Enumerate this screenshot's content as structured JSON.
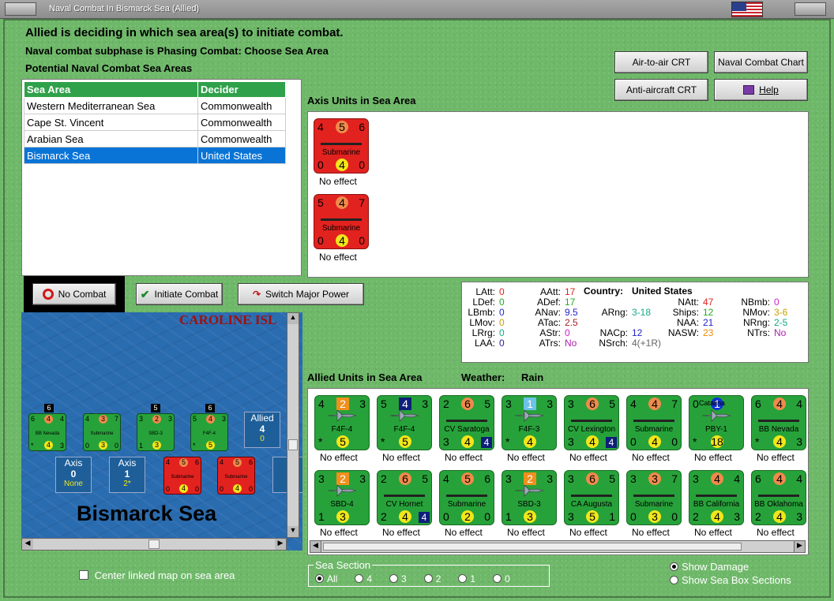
{
  "window": {
    "title": "Naval Combat In Bismarck Sea (Allied)"
  },
  "header": {
    "line1": "Allied is deciding in which sea area(s) to initiate combat.",
    "line2": "Naval combat subphase is Phasing Combat: Choose Sea Area",
    "line3": "Potential Naval Combat Sea Areas"
  },
  "sea_table": {
    "columns": [
      "Sea Area",
      "Decider"
    ],
    "rows": [
      [
        "Western Mediterranean Sea",
        "Commonwealth"
      ],
      [
        "Cape St. Vincent",
        "Commonwealth"
      ],
      [
        "Arabian Sea",
        "Commonwealth"
      ],
      [
        "Bismarck Sea",
        "United States"
      ]
    ],
    "selected_row": 3
  },
  "buttons": {
    "air_to_air": "Air-to-air CRT",
    "naval_chart": "Naval Combat Chart",
    "anti_aircraft": "Anti-aircraft CRT",
    "help": "Help",
    "no_combat": "No Combat",
    "initiate": "Initiate Combat",
    "switch_power": "Switch Major Power"
  },
  "axis_section": {
    "title": "Axis Units in Sea Area",
    "units": [
      {
        "tl": "4",
        "top": "5",
        "tr": "6",
        "name": "Submarine",
        "bl": "0",
        "bot": "4",
        "br": "0",
        "effect": "No effect"
      },
      {
        "tl": "5",
        "top": "4",
        "tr": "7",
        "name": "Submarine",
        "bl": "0",
        "bot": "4",
        "br": "0",
        "effect": "No effect"
      }
    ]
  },
  "stats": {
    "country_label": "Country:",
    "country": "United States",
    "items": [
      {
        "k": "LAtt:",
        "v": "0",
        "c": "#d22"
      },
      {
        "k": "LDef:",
        "v": "0",
        "c": "#2a2"
      },
      {
        "k": "LBmb:",
        "v": "0",
        "c": "#22c"
      },
      {
        "k": "LMov:",
        "v": "0",
        "c": "#c8a000"
      },
      {
        "k": "LRrg:",
        "v": "0",
        "c": "#1a8"
      },
      {
        "k": "LAA:",
        "v": "0",
        "c": "#229"
      },
      {
        "k": "AAtt:",
        "v": "17",
        "c": "#d22"
      },
      {
        "k": "ADef:",
        "v": "17",
        "c": "#2a2"
      },
      {
        "k": "ANav:",
        "v": "9.5",
        "c": "#22c"
      },
      {
        "k": "ATac:",
        "v": "2.5",
        "c": "#a22"
      },
      {
        "k": "AStr:",
        "v": "0",
        "c": "#c2c"
      },
      {
        "k": "ATrs:",
        "v": "No",
        "c": "#a2a"
      },
      {
        "k": "ARng:",
        "v": "3-18",
        "c": "#1a8"
      },
      {
        "k": "NACp:",
        "v": "12",
        "c": "#22c"
      },
      {
        "k": "NSrch:",
        "v": "4(+1R)",
        "c": "#666"
      },
      {
        "k": "NAtt:",
        "v": "47",
        "c": "#d22"
      },
      {
        "k": "Ships:",
        "v": "12",
        "c": "#2a2"
      },
      {
        "k": "NAA:",
        "v": "21",
        "c": "#22c"
      },
      {
        "k": "NASW:",
        "v": "23",
        "c": "#e80"
      },
      {
        "k": "NBmb:",
        "v": "0",
        "c": "#c2c"
      },
      {
        "k": "NMov:",
        "v": "3-6",
        "c": "#c8a000"
      },
      {
        "k": "NRng:",
        "v": "2-5",
        "c": "#1a8"
      },
      {
        "k": "NTrs:",
        "v": "No",
        "c": "#a2a"
      }
    ]
  },
  "allied_section": {
    "title": "Allied Units in Sea Area",
    "weather_label": "Weather:",
    "weather": "Rain",
    "units": [
      {
        "tl": "4",
        "top": "2",
        "tr": "3",
        "tstyle": "sq-orange",
        "name": "F4F-4",
        "kind": "plane",
        "bl": "*",
        "bot": "5",
        "br": "",
        "effect": "No effect"
      },
      {
        "tl": "5",
        "top": "4",
        "tr": "3",
        "tstyle": "sq-navy",
        "name": "F4F-4",
        "kind": "plane",
        "bl": "*",
        "bot": "5",
        "br": "",
        "effect": "No effect"
      },
      {
        "tl": "2",
        "top": "6",
        "tr": "5",
        "tstyle": "circle-orange",
        "name": "CV Saratoga",
        "kind": "ship",
        "bl": "3",
        "bot": "4",
        "br": "4",
        "effect": "No effect"
      },
      {
        "tl": "3",
        "top": "1",
        "tr": "3",
        "tstyle": "sq-lightblue",
        "name": "F4F-3",
        "kind": "plane",
        "bl": "*",
        "bot": "4",
        "br": "",
        "effect": "No effect"
      },
      {
        "tl": "3",
        "top": "6",
        "tr": "5",
        "tstyle": "circle-orange",
        "name": "CV Lexington",
        "kind": "ship",
        "bl": "3",
        "bot": "4",
        "br": "4",
        "effect": "No effect"
      },
      {
        "tl": "4",
        "top": "4",
        "tr": "7",
        "tstyle": "circle-orange",
        "name": "Submarine",
        "kind": "ship",
        "bl": "0",
        "bot": "4",
        "br": "0",
        "effect": "No effect"
      },
      {
        "tl": "0",
        "top": "1",
        "tr": "",
        "tstyle": "circle-blue",
        "name": "PBY-1",
        "kind": "plane",
        "label2": "Catalina",
        "bl": "*",
        "bot": "18",
        "br": "",
        "effect": "No effect"
      },
      {
        "tl": "6",
        "top": "4",
        "tr": "4",
        "tstyle": "circle-orange",
        "name": "BB Nevada",
        "kind": "ship",
        "bl": "*",
        "bot": "4",
        "br": "3",
        "effect": "No effect"
      },
      {
        "tl": "3",
        "top": "2",
        "tr": "3",
        "tstyle": "sq-orange",
        "name": "SBD-4",
        "kind": "plane",
        "bl": "1",
        "bot": "3",
        "br": "",
        "effect": "No effect"
      },
      {
        "tl": "2",
        "top": "6",
        "tr": "5",
        "tstyle": "circle-orange",
        "name": "CV Hornet",
        "kind": "ship",
        "bl": "2",
        "bot": "4",
        "br": "4",
        "effect": "No effect"
      },
      {
        "tl": "4",
        "top": "5",
        "tr": "6",
        "tstyle": "circle-orange",
        "name": "Submarine",
        "kind": "ship",
        "bl": "0",
        "bot": "2",
        "br": "0",
        "effect": "No effect"
      },
      {
        "tl": "3",
        "top": "2",
        "tr": "3",
        "tstyle": "sq-orange",
        "name": "SBD-3",
        "kind": "plane",
        "bl": "1",
        "bot": "3",
        "br": "",
        "effect": "No effect"
      },
      {
        "tl": "3",
        "top": "6",
        "tr": "5",
        "tstyle": "circle-orange",
        "name": "CA Augusta",
        "kind": "ship",
        "bl": "3",
        "bot": "5",
        "br": "1",
        "effect": "No effect"
      },
      {
        "tl": "3",
        "top": "3",
        "tr": "7",
        "tstyle": "circle-orange",
        "name": "Submarine",
        "kind": "ship",
        "bl": "0",
        "bot": "3",
        "br": "0",
        "effect": "No effect"
      },
      {
        "tl": "3",
        "top": "4",
        "tr": "4",
        "tstyle": "circle-orange",
        "name": "BB California",
        "kind": "ship",
        "bl": "2",
        "bot": "4",
        "br": "3",
        "effect": "No effect"
      },
      {
        "tl": "6",
        "top": "4",
        "tr": "4",
        "tstyle": "circle-orange",
        "name": "BB Oklahoma",
        "kind": "ship",
        "bl": "2",
        "bot": "4",
        "br": "3",
        "effect": "No effect"
      }
    ]
  },
  "map": {
    "region_label": "CAROLINE ISL",
    "sea_label": "Bismarck Sea",
    "stack_counts": [
      "6",
      "5",
      "6"
    ],
    "allied_box": {
      "title": "Allied",
      "value": "4",
      "sub": "0"
    },
    "axis_boxes": [
      {
        "title": "Axis",
        "value": "0",
        "sub": "None"
      },
      {
        "title": "Axis",
        "value": "1",
        "sub": "2*"
      }
    ],
    "partial_box": "A",
    "green_units": [
      {
        "tl": "6",
        "top": "4",
        "tr": "4",
        "name": "BB Nevada",
        "bl": "*",
        "bot": "4",
        "br": "3"
      },
      {
        "tl": "4",
        "top": "3",
        "tr": "7",
        "name": "Submarine",
        "bl": "0",
        "bot": "3",
        "br": "0"
      },
      {
        "tl": "3",
        "top": "2",
        "tr": "3",
        "name": "SBD-3",
        "bl": "1",
        "bot": "3",
        "br": ""
      },
      {
        "tl": "5",
        "top": "4",
        "tr": "3",
        "name": "F4F-4",
        "bl": "*",
        "bot": "5",
        "br": ""
      }
    ],
    "red_units": [
      {
        "tl": "4",
        "top": "5",
        "tr": "6",
        "name": "Submarine",
        "bl": "0",
        "bot": "4",
        "br": "0"
      },
      {
        "tl": "4",
        "top": "5",
        "tr": "6",
        "name": "Submarine",
        "bl": "0",
        "bot": "4",
        "br": "0"
      }
    ]
  },
  "center_linked": "Center linked map on sea area",
  "sea_section": {
    "label": "Sea Section",
    "options": [
      "All",
      "4",
      "3",
      "2",
      "1",
      "0"
    ],
    "selected": 0
  },
  "display_options": {
    "show_damage": "Show Damage",
    "show_sections": "Show Sea Box Sections"
  }
}
